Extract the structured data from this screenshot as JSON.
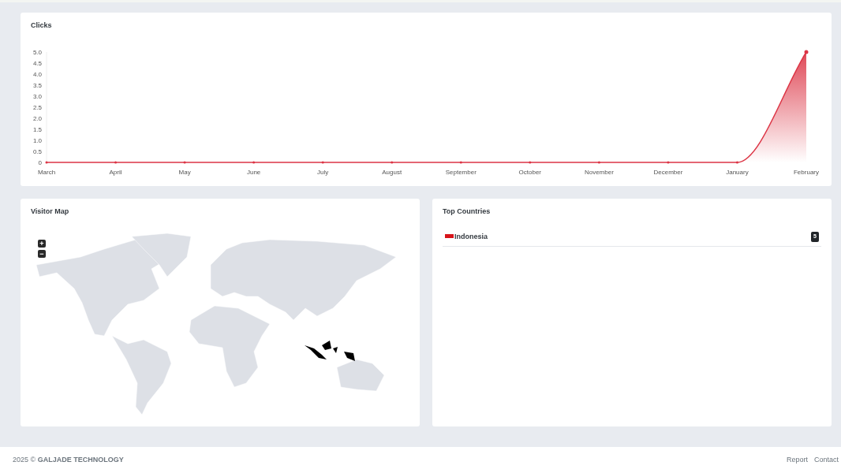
{
  "clicks_card": {
    "title": "Clicks",
    "chart_data": {
      "type": "area",
      "categories": [
        "March",
        "April",
        "May",
        "June",
        "July",
        "August",
        "September",
        "October",
        "November",
        "December",
        "January",
        "February"
      ],
      "series": [
        {
          "color": "#dc3545",
          "values": [
            0,
            0,
            0,
            0,
            0,
            0,
            0,
            0,
            0,
            0,
            0,
            5
          ]
        }
      ],
      "ylim": [
        0,
        5
      ],
      "yticks": [
        {
          "value": 0,
          "label": "0"
        },
        {
          "value": 0.5,
          "label": "0.5"
        },
        {
          "value": 1,
          "label": "1.0"
        },
        {
          "value": 1.5,
          "label": "1.5"
        },
        {
          "value": 2,
          "label": "2.0"
        },
        {
          "value": 2.5,
          "label": "2.5"
        },
        {
          "value": 3,
          "label": "3.0"
        },
        {
          "value": 3.5,
          "label": "3.5"
        },
        {
          "value": 4,
          "label": "4.0"
        },
        {
          "value": 4.5,
          "label": "4.5"
        },
        {
          "value": 5,
          "label": "5.0"
        }
      ]
    }
  },
  "visitor_map": {
    "title": "Visitor Map",
    "zoom_buttons": [
      "+",
      "−"
    ]
  },
  "top_countries": {
    "title": "Top Countries",
    "rows": [
      {
        "country": "Indonesia",
        "count": "5"
      }
    ]
  },
  "footer": {
    "copyright": "2025 © **GALJADE TECHNOLOGY**",
    "links": [
      "Report",
      "Contact"
    ]
  }
}
